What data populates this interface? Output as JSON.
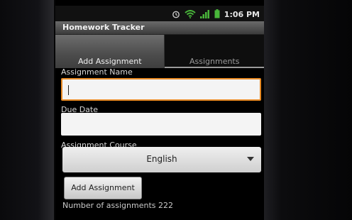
{
  "status_bar": {
    "time": "1:06 PM"
  },
  "app": {
    "title": "Homework Tracker"
  },
  "tabs": [
    {
      "label": "Add Assignment",
      "selected": true
    },
    {
      "label": "Assignments",
      "selected": false
    }
  ],
  "form": {
    "assignment_name": {
      "label": "Assignment Name",
      "value": ""
    },
    "due_date": {
      "label": "Due Date",
      "value": ""
    },
    "assignment_course": {
      "label": "Assignment Course",
      "selected": "English"
    },
    "add_button_label": "Add Assignment"
  },
  "footer": {
    "count_text": "Number of assignments 222"
  },
  "colors": {
    "focus_border": "#e88a24",
    "title_bar": "#4a4a4a",
    "active_tab": "#5a5a5a"
  }
}
